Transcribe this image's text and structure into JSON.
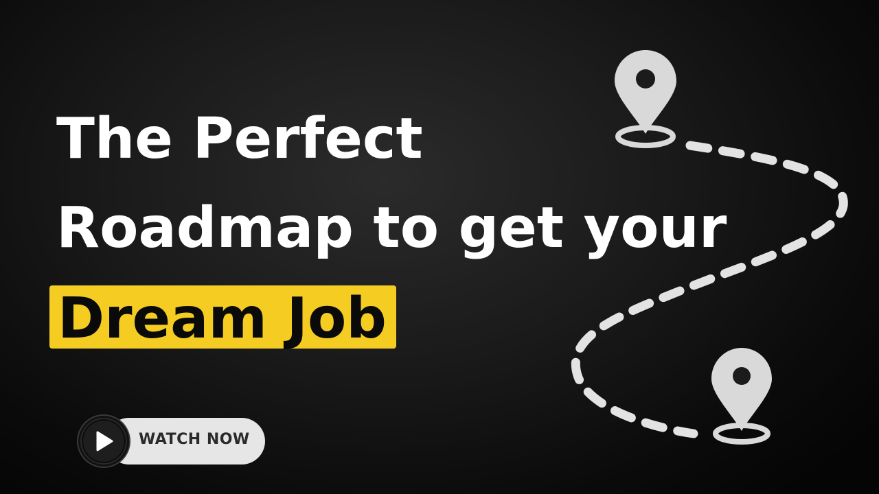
{
  "headline": {
    "line1": "The Perfect",
    "line2": "Roadmap to get your",
    "line3": "Dream Job"
  },
  "cta": {
    "label": "WATCH NOW"
  },
  "colors": {
    "background": "#1a1a1a",
    "highlight": "#f4cc22",
    "text": "#ffffff",
    "pin": "#d9d9d9",
    "pill": "#e6e6e6"
  },
  "icons": {
    "start_pin": "map-pin-icon",
    "end_pin": "map-pin-icon",
    "route": "dashed-route",
    "play": "play-icon"
  }
}
